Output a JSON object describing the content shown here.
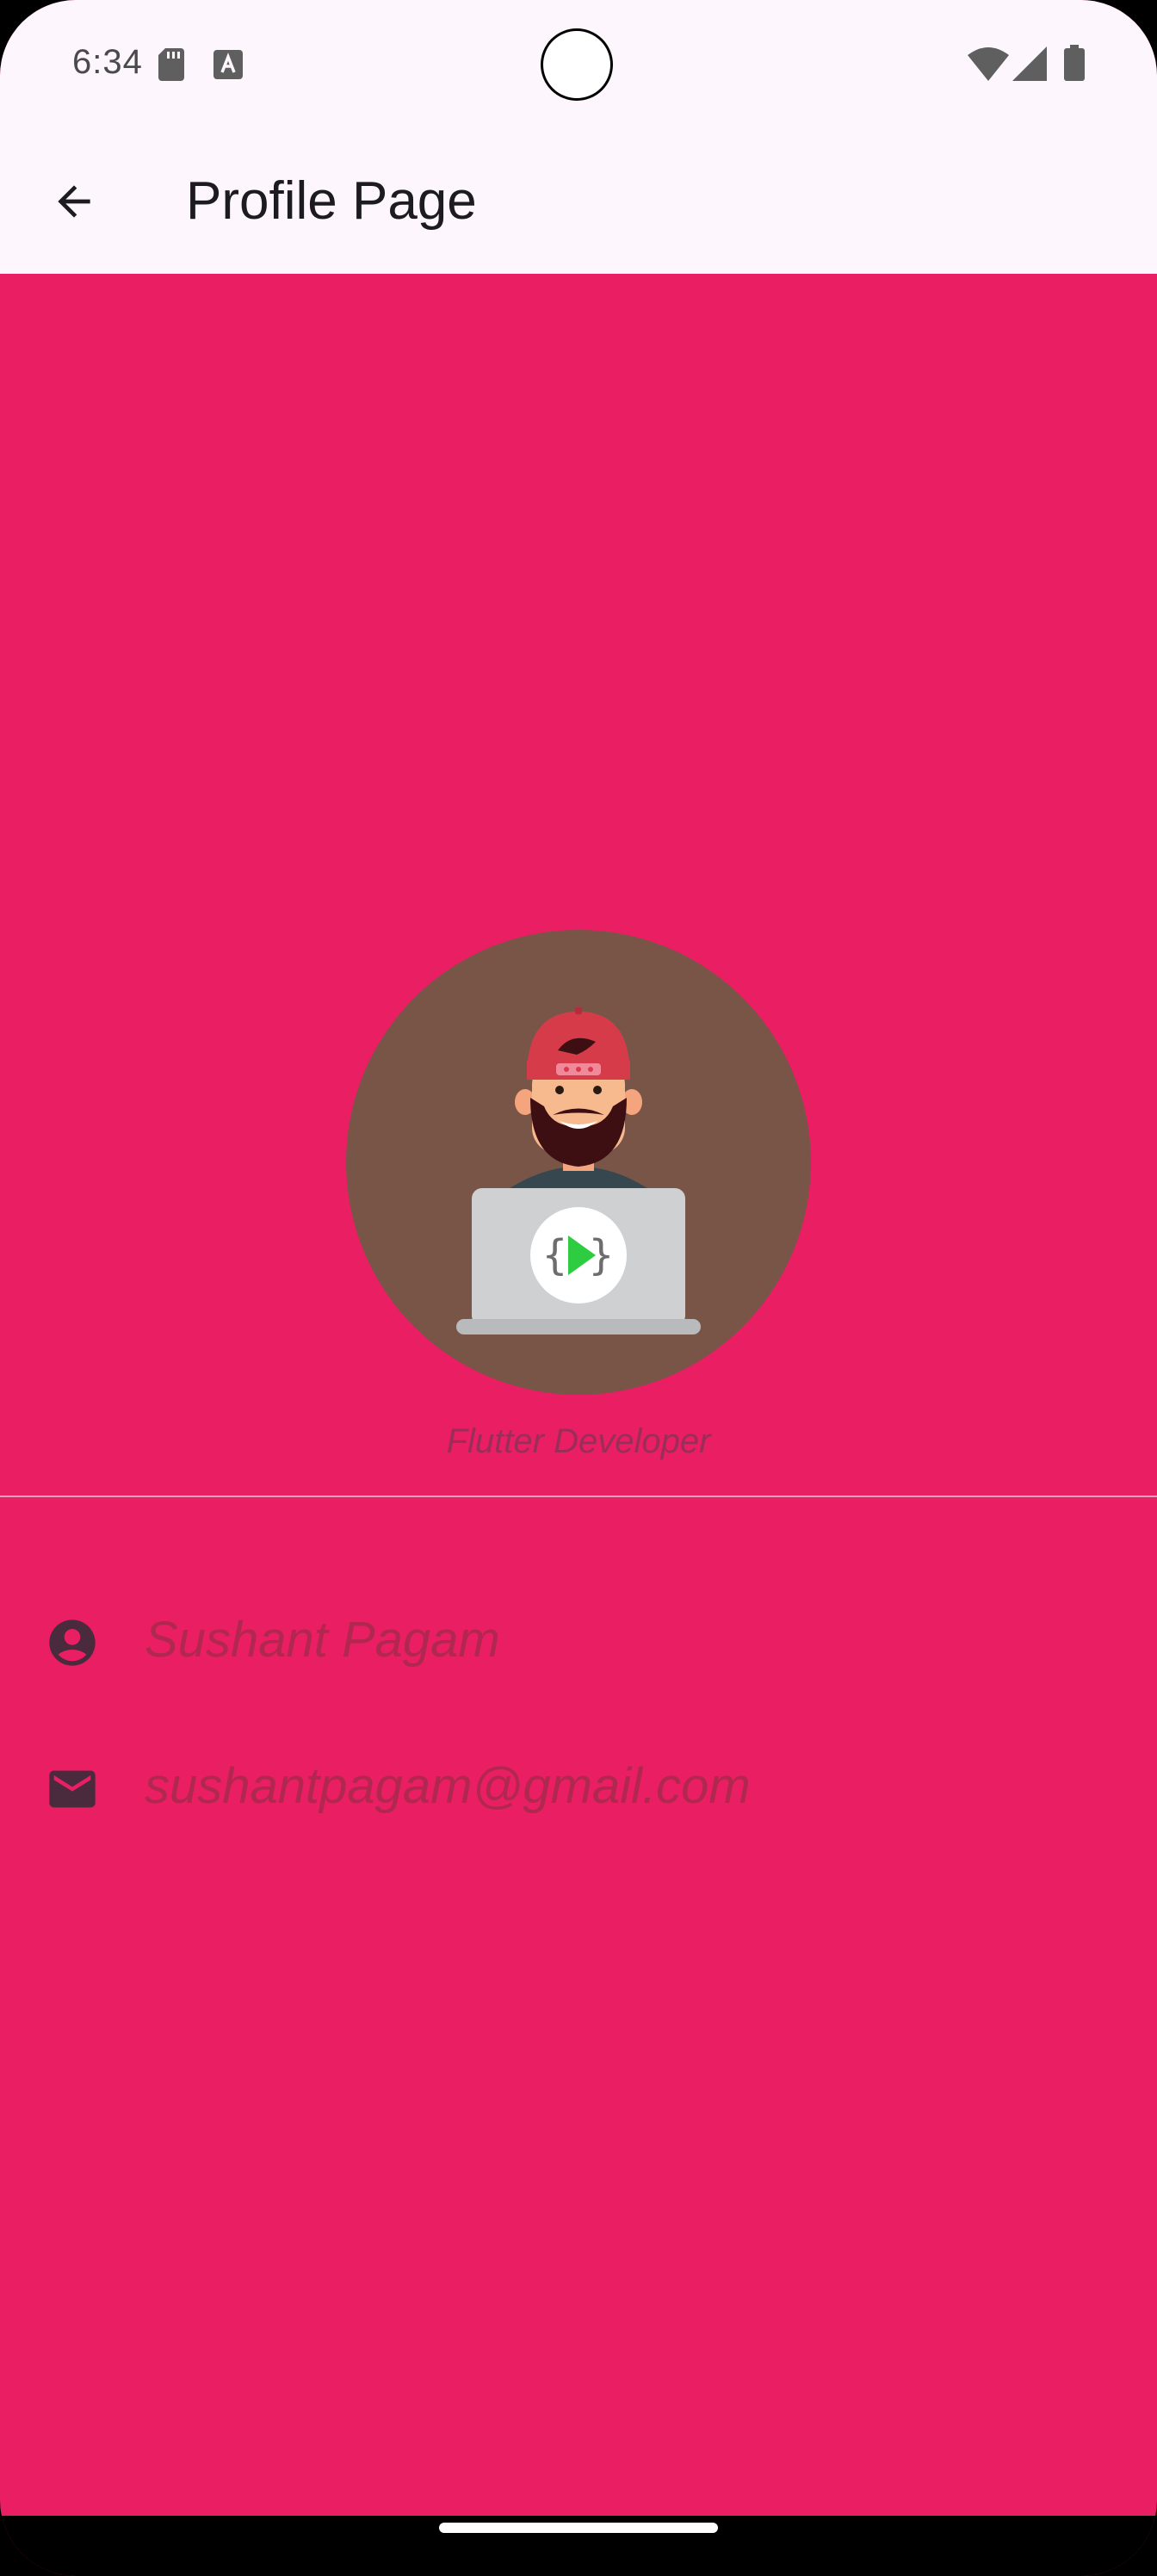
{
  "status_bar": {
    "time": "6:34",
    "icons": [
      "sd-card-icon",
      "a-notification-icon",
      "wifi-icon",
      "signal-icon",
      "battery-icon"
    ]
  },
  "app_bar": {
    "back_icon": "arrow-back-icon",
    "title": "Profile Page"
  },
  "profile": {
    "avatar_icon": "developer-avatar-illustration",
    "subtitle": "Flutter Developer",
    "name": "Sushant Pagam",
    "email": "sushantpagam@gmail.com",
    "name_icon": "account-circle-icon",
    "email_icon": "mail-icon"
  },
  "colors": {
    "page_background": "#E91E63",
    "app_bar_background": "#FDF6FC",
    "avatar_background": "#795548",
    "info_text": "#B0284F",
    "icon_color": "#4A2A3D"
  }
}
